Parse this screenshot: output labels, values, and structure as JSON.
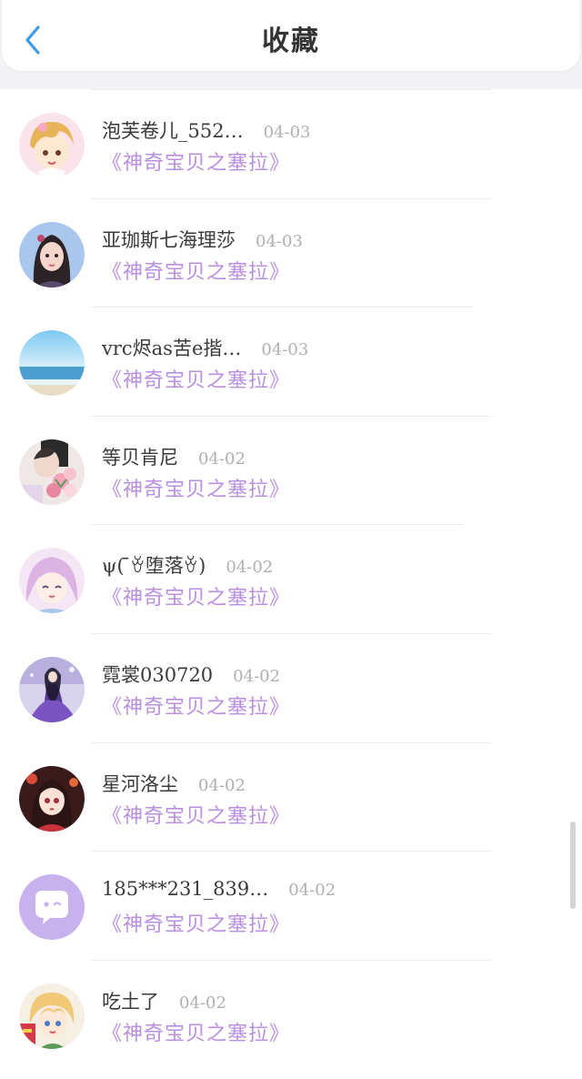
{
  "header": {
    "title": "收藏"
  },
  "items": [
    {
      "name": "泡芙卷儿_552…",
      "date": "04-03",
      "book": "《神奇宝贝之塞拉》",
      "avatar": "anime-girl-avatar"
    },
    {
      "name": "亚珈斯七海理莎",
      "date": "04-03",
      "book": "《神奇宝贝之塞拉》",
      "avatar": "girl-photo-avatar"
    },
    {
      "name": "vrc烬as苦e揩…",
      "date": "04-03",
      "book": "《神奇宝贝之塞拉》",
      "avatar": "beach-avatar"
    },
    {
      "name": "等贝肯尼",
      "date": "04-02",
      "book": "《神奇宝贝之塞拉》",
      "avatar": "flowers-avatar"
    },
    {
      "name": "ψ( ̄ꈊ堕落ꈊ)",
      "date": "04-02",
      "book": "《神奇宝贝之塞拉》",
      "avatar": "pink-hair-avatar"
    },
    {
      "name": "霓裳030720",
      "date": "04-02",
      "book": "《神奇宝贝之塞拉》",
      "avatar": "purple-kimono-avatar"
    },
    {
      "name": "星河洛尘",
      "date": "04-02",
      "book": "《神奇宝贝之塞拉》",
      "avatar": "red-kimono-avatar"
    },
    {
      "name": "185***231_839…",
      "date": "04-02",
      "book": "《神奇宝贝之塞拉》",
      "avatar": "default-chat-avatar"
    },
    {
      "name": "吃土了",
      "date": "04-02",
      "book": "《神奇宝贝之塞拉》",
      "avatar": "blonde-boy-avatar"
    }
  ]
}
